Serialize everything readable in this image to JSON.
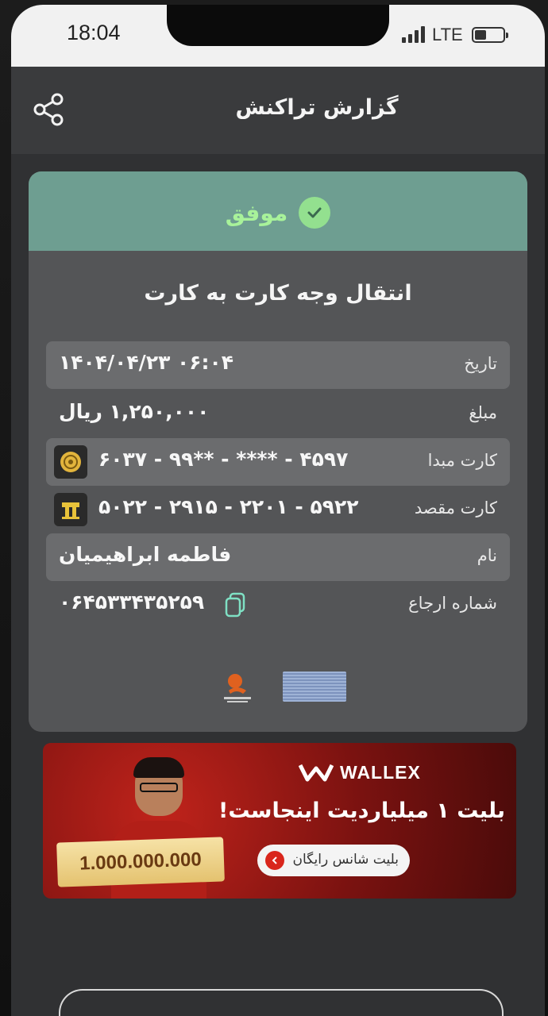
{
  "status_bar": {
    "time": "18:04",
    "network": "LTE"
  },
  "header": {
    "title": "گزارش تراکنش",
    "share_icon": "share-icon"
  },
  "receipt": {
    "status": "موفق",
    "status_color": "#a8f29a",
    "title": "انتقال وجه کارت به کارت",
    "rows": [
      {
        "label": "تاریخ",
        "value": "۱۴۰۴/۰۴/۲۳  ۰۶:۰۴"
      },
      {
        "label": "مبلغ",
        "value": "۱,۲۵۰,۰۰۰ ریال"
      },
      {
        "label": "کارت مبدا",
        "value": "۶۰۳۷ - ۹۹** - **** - ۴۵۹۷"
      },
      {
        "label": "کارت مقصد",
        "value": "۵۰۲۲ - ۲۹۱۵ - ۲۲۰۱ - ۵۹۲۲"
      },
      {
        "label": "نام",
        "value": "فاطمه ابراهیمیان"
      },
      {
        "label": "شماره ارجاع",
        "value": "۰۶۴۵۳۳۴۳۵۲۵۹"
      }
    ]
  },
  "banner": {
    "brand": "WALLEX",
    "headline": "بلیت ۱ میلیاردیت اینجاست!",
    "prize": "1.000.000.000",
    "cta": "بلیت شانس رایگان",
    "accent": "#d9261c"
  }
}
